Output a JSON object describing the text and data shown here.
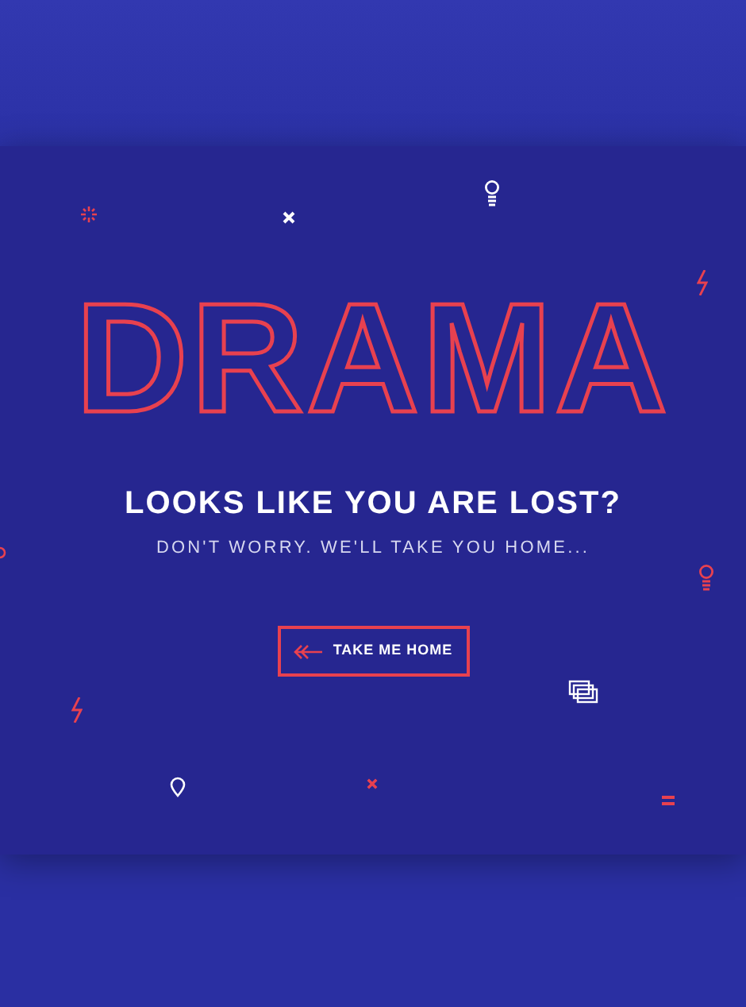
{
  "logo": {
    "text": "DRAMA"
  },
  "heading": "LOOKS LIKE YOU ARE LOST?",
  "subheading": "DON'T WORRY. WE'LL TAKE YOU HOME...",
  "button": {
    "label": "TAKE ME HOME"
  }
}
